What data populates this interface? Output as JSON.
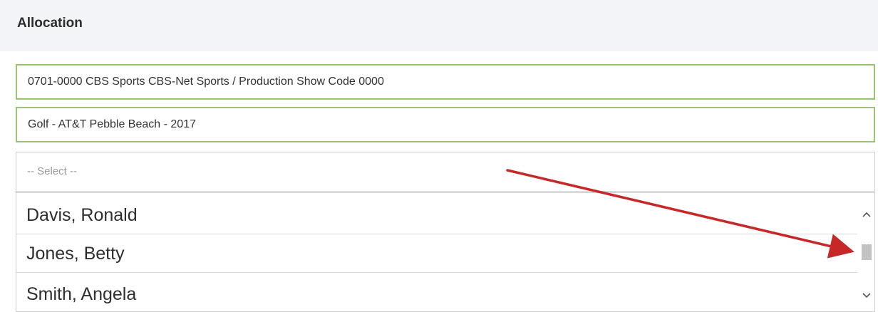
{
  "section": {
    "title": "Allocation"
  },
  "fields": {
    "cost_center": "0701-0000 CBS Sports CBS-Net Sports / Production Show Code 0000",
    "event": "Golf - AT&T Pebble Beach - 2017"
  },
  "select": {
    "placeholder": "-- Select --",
    "options": [
      "Davis, Ronald",
      "Jones, Betty",
      "Smith, Angela"
    ]
  },
  "scrollbar": {
    "up_glyph": "⌃",
    "down_glyph": "⌄"
  },
  "annotation": {
    "arrow_color": "#c62828"
  }
}
